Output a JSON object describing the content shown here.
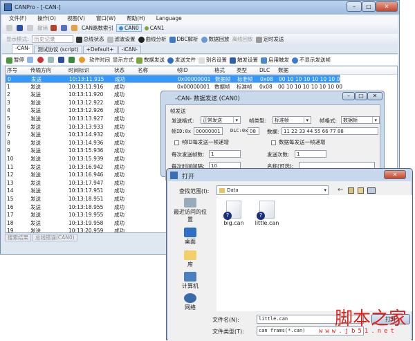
{
  "window": {
    "title": "CANPro - [-CAN-]"
  },
  "menu": [
    "文件(F)",
    "操作(O)",
    "视图(V)",
    "窗口(W)",
    "帮助(H)",
    "Language"
  ],
  "toolbar1": {
    "disabled": "撤销",
    "can_index_label": "CAN路数索引",
    "can0": "CAN0",
    "can1": "CAN1"
  },
  "toolbar2": {
    "display_mode_label": "显示模式:",
    "display_mode_value": "历史记录",
    "items": [
      "总线状态",
      "滤波设置",
      "曲线分析",
      "DBC解析",
      "数据回放",
      "离线回放",
      "定时发送"
    ]
  },
  "tabs": [
    "-CAN-",
    "测试协议 (script)",
    "+Default+",
    "-iCAN-"
  ],
  "toolbar3": [
    "暂停",
    "软件时间",
    "显示方式",
    "数据发送",
    "发送文件",
    "别名设置",
    "触发设置",
    "启用触发",
    "不显示发送帧"
  ],
  "table": {
    "columns": [
      "序号",
      "传输方向",
      "时间标识",
      "状态",
      "名称",
      "帧ID",
      "格式",
      "类型",
      "DLC",
      "数据"
    ],
    "rows": [
      [
        "0",
        "发送",
        "10:13:11.915",
        "成功",
        "",
        "0x00000001",
        "数据帧",
        "标准帧",
        "0x08",
        "00 10 10 10 10 10 10 00"
      ],
      [
        "1",
        "发送",
        "10:13:11.916",
        "成功",
        "",
        "0x00000001",
        "数据帧",
        "标准帧",
        "0x08",
        "00 10 10 10 10 10 10 00"
      ],
      [
        "2",
        "发送",
        "10:13:11.920",
        "成功"
      ],
      [
        "3",
        "发送",
        "10:13:12.922",
        "成功"
      ],
      [
        "4",
        "发送",
        "10:13:12.926",
        "成功"
      ],
      [
        "5",
        "发送",
        "10:13:13.927",
        "成功"
      ],
      [
        "6",
        "发送",
        "10:13:13.933",
        "成功"
      ],
      [
        "7",
        "发送",
        "10:13:14.932",
        "成功"
      ],
      [
        "8",
        "发送",
        "10:13:14.936",
        "成功"
      ],
      [
        "9",
        "发送",
        "10:13:15.936",
        "成功"
      ],
      [
        "10",
        "发送",
        "10:13:15.939",
        "成功"
      ],
      [
        "11",
        "发送",
        "10:13:16.942",
        "成功"
      ],
      [
        "12",
        "发送",
        "10:13:16.946",
        "成功"
      ],
      [
        "13",
        "发送",
        "10:13:17.947",
        "成功"
      ],
      [
        "14",
        "发送",
        "10:13:17.951",
        "成功"
      ],
      [
        "15",
        "发送",
        "10:13:18.951",
        "成功"
      ],
      [
        "16",
        "发送",
        "10:13:18.955",
        "成功"
      ],
      [
        "17",
        "发送",
        "10:13:19.955",
        "成功"
      ],
      [
        "18",
        "发送",
        "10:13:19.958",
        "成功"
      ],
      [
        "19",
        "发送",
        "10:13:20.959",
        "成功"
      ]
    ]
  },
  "bottom_tabs": [
    "搜索结果",
    "总线错误(CAN0)"
  ],
  "send_dialog": {
    "title": "-CAN- 数据发送 (CAN0)",
    "group": "帧发送",
    "send_format_label": "发送格式:",
    "send_format": "正常发送",
    "frame_type_label": "帧类型:",
    "frame_type": "标准帧",
    "frame_format_label": "帧格式:",
    "frame_format": "数据帧",
    "frame_id_label": "帧ID:0x",
    "frame_id": "00000001",
    "dlc_label": "DLC:0x",
    "dlc": "08",
    "data_label": "数据:",
    "data": "11 22 33 44 55 66 77 88",
    "id_increment": "帧ID每发送一帧递增",
    "data_increment": "数据每发送一帧递增",
    "frames_per_send_label": "每次发送帧数:",
    "frames_per_send": "1",
    "send_count_label": "发送次数:",
    "send_count": "1",
    "interval_label": "每次时间间隔:",
    "interval": "10",
    "name_label": "名称(可选):"
  },
  "open_dialog": {
    "title": "打开",
    "look_in_label": "查找范围(I):",
    "look_in": "Data",
    "places": [
      "最近访问的位置",
      "桌面",
      "库",
      "计算机",
      "网络"
    ],
    "files": [
      "big.can",
      "little.can"
    ],
    "filename_label": "文件名(N):",
    "filename": "little.can",
    "filetype_label": "文件类型(T):",
    "filetype": "can frams(*.can)",
    "open_button": "打开"
  },
  "watermark": {
    "text": "脚本之家",
    "url": "www.jb51.net"
  }
}
